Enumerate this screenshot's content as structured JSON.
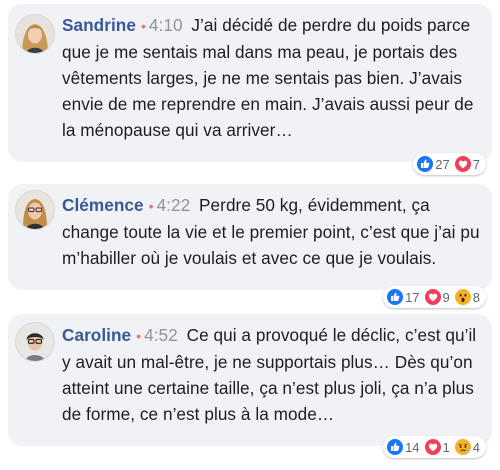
{
  "comments": [
    {
      "author": "Sandrine",
      "separator": "•",
      "time": "4:10",
      "text": "J’ai décidé de perdre du poids parce que je me sentais mal dans ma peau, je portais des vêtements larges, je ne me sentais pas bien. J’avais envie de me reprendre en main. J’avais aussi peur de la ménopause qui va arriver…",
      "reactions": [
        {
          "icon": "like-icon",
          "color": "#1877f2",
          "count": "27"
        },
        {
          "icon": "love-icon",
          "color": "#f33e58",
          "count": "7"
        }
      ]
    },
    {
      "author": "Clémence",
      "separator": "•",
      "time": "4:22",
      "text": "Perdre 50 kg, évidemment, ça change toute la vie et le premier point, c’est que j’ai pu m’habiller où je voulais et avec ce que je voulais.",
      "reactions": [
        {
          "icon": "like-icon",
          "color": "#1877f2",
          "count": "17"
        },
        {
          "icon": "love-icon",
          "color": "#f33e58",
          "count": "9"
        },
        {
          "icon": "wow-icon",
          "color": "#f7b125",
          "count": "8"
        }
      ]
    },
    {
      "author": "Caroline",
      "separator": "•",
      "time": "4:52",
      "text": "Ce qui a provoqué le déclic, c’est qu’il y avait un mal-être, je ne supportais plus… Dès qu’on atteint une certaine taille, ça n’est plus joli, ça n’a plus de forme, ce n’est plus à la mode…",
      "reactions": [
        {
          "icon": "like-icon",
          "color": "#1877f2",
          "count": "14"
        },
        {
          "icon": "love-icon",
          "color": "#f33e58",
          "count": "1"
        },
        {
          "icon": "sad-icon",
          "color": "#f7b125",
          "count": "4"
        }
      ]
    }
  ]
}
